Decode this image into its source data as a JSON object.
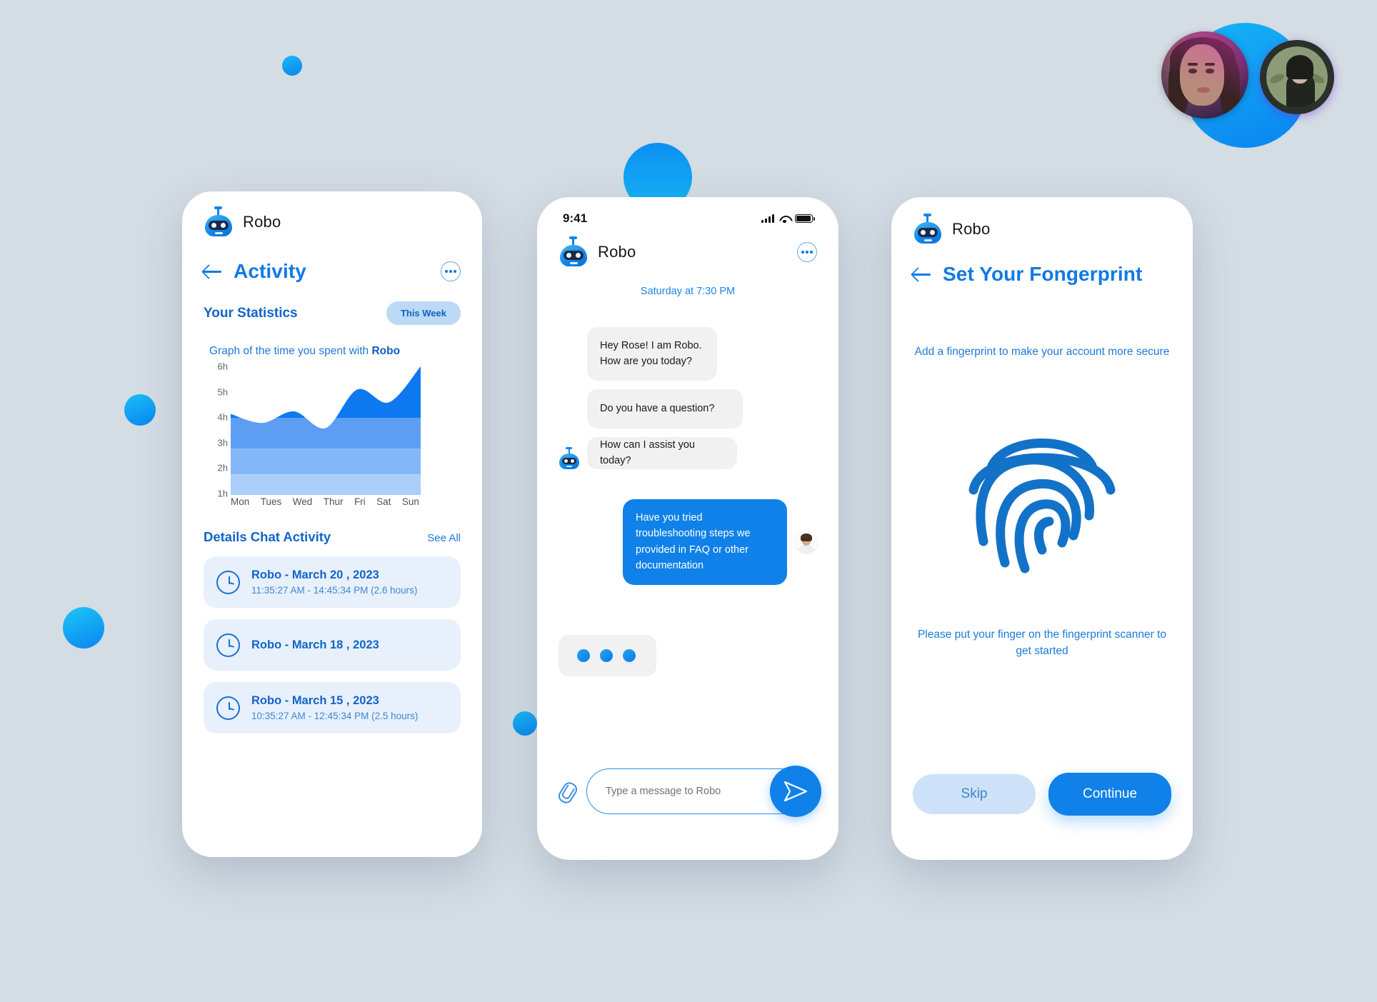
{
  "theme": {
    "background": "#d4dce4",
    "primary_blue": "#1081e8",
    "title_blue": "#1179e6",
    "card_blue": "#e8f0fb",
    "pill_blue": "#bcd9f6"
  },
  "brand": {
    "name": "Robo"
  },
  "activity_screen": {
    "brand_name": "Robo",
    "title": "Activity",
    "statistics_label": "Your Statistics",
    "period_pill": "This Week",
    "graph_caption_prefix": "Graph of the time you spent with ",
    "graph_caption_bold": "Robo",
    "details_title": "Details Chat Activity",
    "see_all": "See All",
    "activities": [
      {
        "name": "Robo - March 20 , 2023",
        "time": "11:35:27 AM - 14:45:34 PM (2.6 hours)"
      },
      {
        "name": "Robo - March 18 , 2023",
        "time": ""
      },
      {
        "name": "Robo - March 15 , 2023",
        "time": "10:35:27 AM - 12:45:34 PM (2.5 hours)"
      }
    ]
  },
  "chart_data": {
    "type": "area",
    "title": "Graph of the time you spent with Robo",
    "xlabel": "",
    "ylabel": "",
    "categories": [
      "Mon",
      "Tues",
      "Wed",
      "Thur",
      "Fri",
      "Sat",
      "Sun"
    ],
    "values": [
      4.15,
      3.8,
      4.25,
      3.6,
      5.1,
      4.6,
      6.0
    ],
    "ytick_labels": [
      "1h",
      "2h",
      "3h",
      "4h",
      "5h",
      "6h"
    ],
    "ytick_values": [
      1,
      2,
      3,
      4,
      5,
      6
    ],
    "ylim": [
      1,
      6
    ],
    "grid": false,
    "legend": false,
    "band_boundaries": [
      1.8,
      2.8,
      4.0
    ],
    "band_colors": [
      "#a9cffa",
      "#84b7f7",
      "#5d9ef2",
      "#0d78ef"
    ],
    "note": "Stacked horizontal color bands fill the area under a smooth curve"
  },
  "chat_screen": {
    "status_time": "9:41",
    "brand_name": "Robo",
    "date_divider": "Saturday at 7:30 PM",
    "messages": [
      {
        "from": "bot",
        "text": "Hey Rose! I am Robo. How are you today?"
      },
      {
        "from": "bot",
        "text": "Do you have a question?"
      },
      {
        "from": "bot",
        "text": "How can I assist you today?"
      },
      {
        "from": "user",
        "text": "Have you tried troubleshooting steps we provided in FAQ or other documentation"
      }
    ],
    "typing_indicator": true,
    "input_placeholder": "Type a message to Robo",
    "input_value": ""
  },
  "fingerprint_screen": {
    "brand_name": "Robo",
    "title": "Set Your Fongerprint",
    "description": "Add a fingerprint to make your account more secure",
    "instruction": "Please put your finger on the fingerprint scanner to get started",
    "skip_label": "Skip",
    "continue_label": "Continue"
  }
}
